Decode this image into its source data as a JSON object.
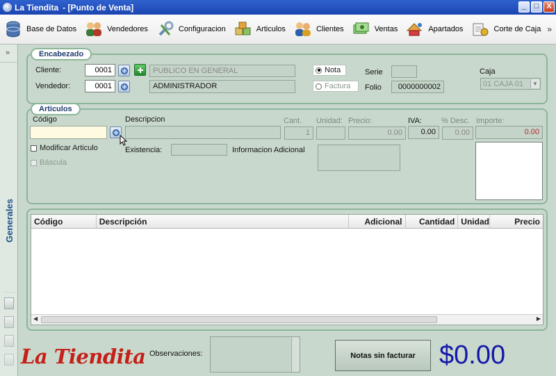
{
  "window": {
    "app_name": "La Tiendita",
    "subtitle": "- [Punto de Venta]",
    "buttons": [
      "_",
      "□",
      "X"
    ]
  },
  "toolbar": {
    "items": [
      {
        "label": "Base de Datos",
        "icon": "database-icon"
      },
      {
        "label": "Vendedores",
        "icon": "people-icon"
      },
      {
        "label": "Configuracion",
        "icon": "tools-icon"
      },
      {
        "label": "Articulos",
        "icon": "boxes-icon"
      },
      {
        "label": "Clientes",
        "icon": "clients-icon"
      },
      {
        "label": "Ventas",
        "icon": "sales-icon"
      },
      {
        "label": "Apartados",
        "icon": "layaway-icon"
      },
      {
        "label": "Corte de Caja",
        "icon": "cash-cut-icon"
      }
    ],
    "more": "»"
  },
  "rail": {
    "expand": "»",
    "label": "Generales",
    "dots": "·····"
  },
  "encabezado": {
    "legend": "Encabezado",
    "cliente_label": "Cliente:",
    "cliente_id": "0001",
    "cliente_name": "PUBLICO EN GENERAL",
    "vendedor_label": "Vendedor:",
    "vendedor_id": "0001",
    "vendedor_name": "ADMINISTRADOR",
    "nota": "Nota",
    "factura": "Factura",
    "serie_label": "Serie",
    "serie_value": "",
    "folio_label": "Folio",
    "folio_value": "0000000002",
    "caja_label": "Caja",
    "caja_value": "01  CAJA 01"
  },
  "articulos": {
    "legend": "Articulos",
    "codigo_label": "Código",
    "codigo_value": "",
    "descripcion_label": "Descripcion",
    "descripcion_value": "",
    "cant_label": "Cant.",
    "cant_value": "1",
    "unidad_label": "Unidad:",
    "unidad_value": "",
    "precio_label": "Precio:",
    "precio_value": "0.00",
    "iva_label": "IVA:",
    "iva_value": "0.00",
    "desc_label": "% Desc.",
    "desc_value": "0.00",
    "importe_label": "Importe:",
    "importe_value": "0.00",
    "modificar": "Modificar Articulo",
    "bascula": "Báscula",
    "existencia_label": "Existencia:",
    "existencia_value": "",
    "info_label": "Informacion Adicional"
  },
  "grid": {
    "columns": [
      "Código",
      "Descripción",
      "Adicional",
      "Cantidad",
      "Unidad",
      "Precio"
    ],
    "rows": []
  },
  "footer": {
    "logo": "La Tiendita",
    "observaciones_label": "Observaciones:",
    "notas_button": "Notas sin facturar",
    "total": "$0.00"
  },
  "colors": {
    "background": "#c9d8cc",
    "frame": "#8cb59a",
    "title_bar": "#1b45b0",
    "logo": "#c4201a",
    "total": "#1418a8"
  }
}
